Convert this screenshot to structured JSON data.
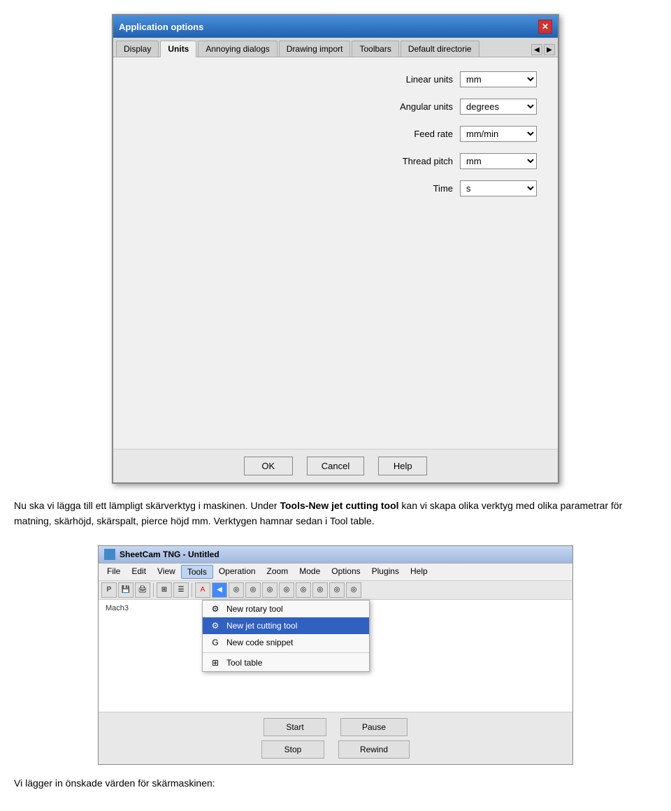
{
  "dialog": {
    "title": "Application options",
    "close_btn": "✕",
    "tabs": [
      {
        "label": "Display",
        "active": false
      },
      {
        "label": "Units",
        "active": true
      },
      {
        "label": "Annoying dialogs",
        "active": false
      },
      {
        "label": "Drawing import",
        "active": false
      },
      {
        "label": "Toolbars",
        "active": false
      },
      {
        "label": "Default directorie",
        "active": false
      }
    ],
    "fields": [
      {
        "label": "Linear units",
        "value": "mm"
      },
      {
        "label": "Angular units",
        "value": "degrees"
      },
      {
        "label": "Feed rate",
        "value": "mm/min"
      },
      {
        "label": "Thread pitch",
        "value": "mm"
      },
      {
        "label": "Time",
        "value": "s"
      }
    ],
    "buttons": [
      "OK",
      "Cancel",
      "Help"
    ]
  },
  "text1": "Nu ska vi lägga till ett lämpligt skärverktyg i maskinen. Under ",
  "text1_bold": "Tools-New jet cutting tool",
  "text1_end": " kan vi skapa olika verktyg med olika parametrar för matning, skärhöjd, skärspalt, pierce höjd mm. Verktygen hamnar sedan i Tool table.",
  "app": {
    "title": "SheetCam TNG - Untitled",
    "menus": [
      "File",
      "Edit",
      "View",
      "Tools",
      "Operation",
      "Zoom",
      "Mode",
      "Options",
      "Plugins",
      "Help"
    ],
    "active_menu": "Tools",
    "statuslabel": "Mach3",
    "dropdown": {
      "items": [
        {
          "label": "New rotary tool",
          "icon": "⚙",
          "selected": false
        },
        {
          "label": "New jet cutting tool",
          "icon": "⚙",
          "selected": true
        },
        {
          "label": "New code snippet",
          "icon": "G",
          "selected": false
        },
        {
          "separator": true
        },
        {
          "label": "Tool table",
          "icon": "⊞",
          "selected": false
        }
      ]
    },
    "controls": {
      "row1": [
        "Start",
        "Pause"
      ],
      "row2": [
        "Stop",
        "Rewind"
      ]
    }
  },
  "bottom_text": "Vi lägger in önskade värden för skärmaskinen:"
}
